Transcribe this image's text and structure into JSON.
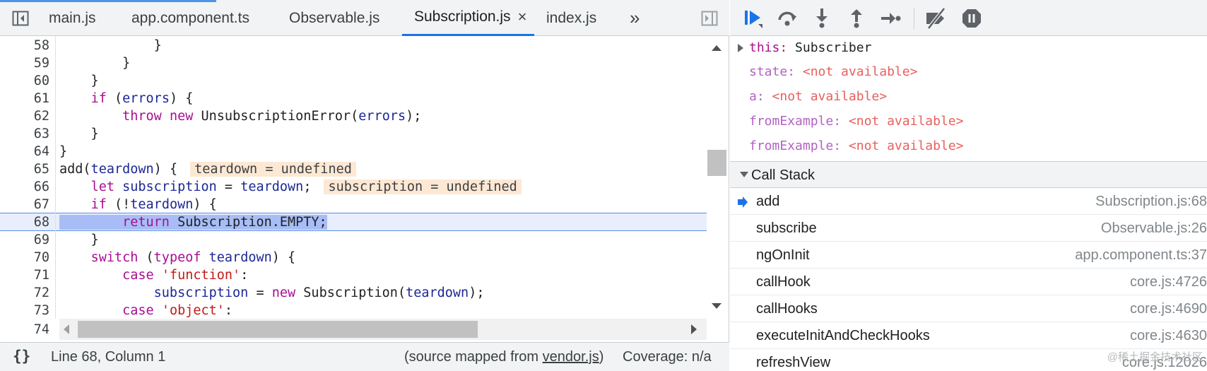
{
  "tabs": [
    {
      "label": "main.js"
    },
    {
      "label": "app.component.ts"
    },
    {
      "label": "Observable.js"
    },
    {
      "label": "Subscription.js",
      "close": "×"
    },
    {
      "label": "index.js"
    }
  ],
  "tab_overflow": "»",
  "code_lines": [
    {
      "ln": "58"
    },
    {
      "ln": "59"
    },
    {
      "ln": "60"
    },
    {
      "ln": "61"
    },
    {
      "ln": "62"
    },
    {
      "ln": "63"
    },
    {
      "ln": "64"
    },
    {
      "ln": "65",
      "inline": "teardown = undefined"
    },
    {
      "ln": "66",
      "inline": "subscription = undefined"
    },
    {
      "ln": "67"
    },
    {
      "ln": "68"
    },
    {
      "ln": "69"
    },
    {
      "ln": "70"
    },
    {
      "ln": "71"
    },
    {
      "ln": "72"
    },
    {
      "ln": "73"
    },
    {
      "ln": "74"
    }
  ],
  "status": {
    "braces": "{}",
    "position": "Line 68, Column 1",
    "mapped_prefix": "(source mapped from ",
    "mapped_link": "vendor.js",
    "mapped_suffix": ")",
    "coverage": "Coverage: n/a"
  },
  "scope": {
    "this_key": "this",
    "this_value": "Subscriber",
    "items": [
      {
        "key": "state",
        "value": "<not available>"
      },
      {
        "key": "a",
        "value": "<not available>"
      },
      {
        "key": "fromExample",
        "value": "<not available>"
      },
      {
        "key": "fromExample",
        "value": "<not available>"
      }
    ]
  },
  "call_stack": {
    "title": "Call Stack",
    "frames": [
      {
        "fn": "add",
        "loc": "Subscription.js:68"
      },
      {
        "fn": "subscribe",
        "loc": "Observable.js:26"
      },
      {
        "fn": "ngOnInit",
        "loc": "app.component.ts:37"
      },
      {
        "fn": "callHook",
        "loc": "core.js:4726"
      },
      {
        "fn": "callHooks",
        "loc": "core.js:4690"
      },
      {
        "fn": "executeInitAndCheckHooks",
        "loc": "core.js:4630"
      },
      {
        "fn": "refreshView",
        "loc": "core.js:12026"
      }
    ]
  },
  "watermark": "@稀土掘金技术社区",
  "colors": {
    "accent": "#1a73e8",
    "keyword": "#aa0d91",
    "identifier": "#1c2896",
    "string": "#c41a16",
    "not_available": "#e8605d",
    "current_line": "#e8eefc"
  },
  "icons": {
    "navigator_toggle": "sidebar-left-icon",
    "debugger_toggle": "sidebar-right-icon",
    "resume": "resume-icon",
    "step_over": "step-over-icon",
    "step_into": "step-into-icon",
    "step_out": "step-out-icon",
    "step": "step-icon",
    "deactivate_breakpoints": "deactivate-breakpoints-icon",
    "pause_exceptions": "pause-on-exceptions-icon"
  }
}
